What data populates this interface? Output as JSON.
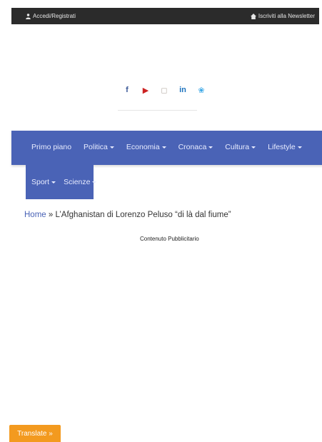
{
  "topbar": {
    "login_label": "Accedi/Registrati",
    "newsletter_label": "Iscriviti alla Newsletter"
  },
  "social": {
    "facebook": "f",
    "youtube": "▶",
    "instagram": "◻",
    "linkedin": "in",
    "twitter": "❀"
  },
  "nav": {
    "row1": [
      "Primo piano",
      "Politica",
      "Economia",
      "Cronaca",
      "Cultura",
      "Lifestyle"
    ],
    "row2": [
      "Sport",
      "Scienze"
    ]
  },
  "breadcrumb": {
    "home": "Home",
    "separator": " » ",
    "current": "L’Afghanistan di Lorenzo Peluso “di là dal fiume”"
  },
  "ad_label": "Contenuto Pubblicitario",
  "translate_label": "Translate »",
  "colors": {
    "topbar": "#2b2b2b",
    "nav": "#4a63b6",
    "translate": "#f39a1f",
    "facebook": "#3b5998",
    "youtube": "#cc2222",
    "instagram": "#b8b0a8",
    "linkedin": "#1e73be",
    "twitter": "#3aa7e6"
  }
}
